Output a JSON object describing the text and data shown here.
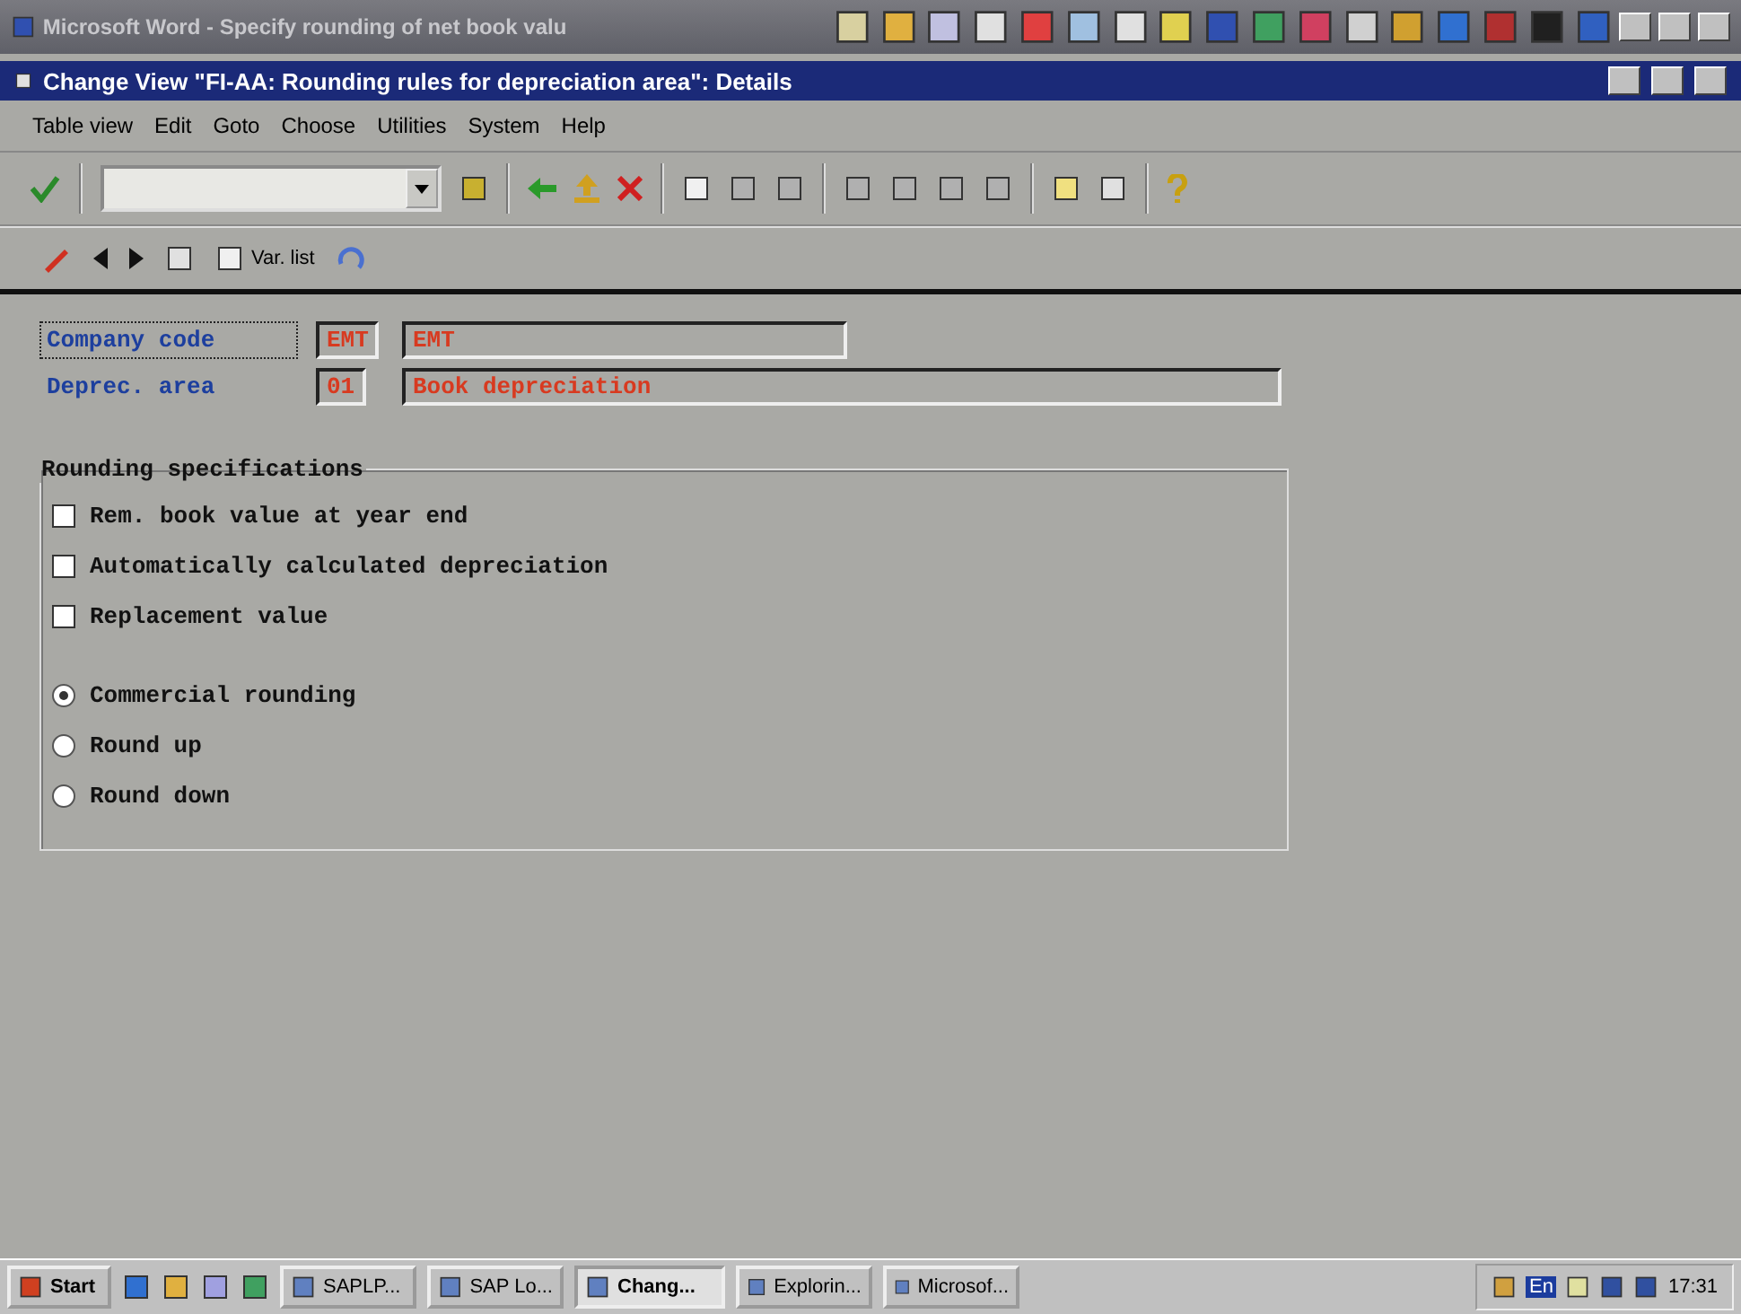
{
  "outer_window": {
    "title": "Microsoft Word - Specify rounding of net book valu"
  },
  "sap_window": {
    "title": "Change View \"FI-AA: Rounding rules for depreciation area\": Details"
  },
  "menu": {
    "items": [
      "Table view",
      "Edit",
      "Goto",
      "Choose",
      "Utilities",
      "System",
      "Help"
    ]
  },
  "application_toolbar": {
    "var_list": "Var. list"
  },
  "fields": [
    {
      "label": "Company code",
      "key": "EMT",
      "description": "EMT",
      "focused": true
    },
    {
      "label": "Deprec. area",
      "key": "01",
      "description": "Book depreciation",
      "focused": false
    }
  ],
  "rounding": {
    "title": "Rounding specifications",
    "checkboxes": [
      {
        "label": "Rem. book value at year end",
        "checked": false
      },
      {
        "label": "Automatically calculated depreciation",
        "checked": false
      },
      {
        "label": "Replacement value",
        "checked": false
      }
    ],
    "radios": [
      {
        "label": "Commercial rounding",
        "selected": true
      },
      {
        "label": "Round up",
        "selected": false
      },
      {
        "label": "Round down",
        "selected": false
      }
    ]
  },
  "taskbar": {
    "start": "Start",
    "tasks": [
      {
        "label": "SAPLP...",
        "selected": false
      },
      {
        "label": "SAP Lo...",
        "selected": false
      },
      {
        "label": "Chang...",
        "selected": true
      },
      {
        "label": "Explorin...",
        "selected": false
      },
      {
        "label": "Microsof...",
        "selected": false
      }
    ],
    "language": "En",
    "clock": "17:31"
  }
}
